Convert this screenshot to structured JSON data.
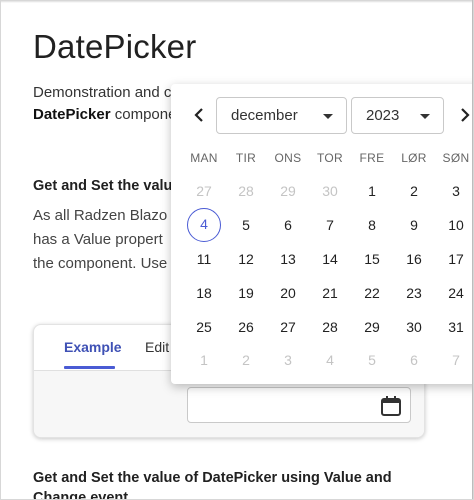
{
  "page": {
    "title": "DatePicker",
    "intro_line1": "Demonstration and c",
    "intro_line2_bold": "DatePicker",
    "intro_line2_rest": " compone"
  },
  "section1": {
    "heading": "Get and Set the valu",
    "body_line1": "As all Radzen Blazo",
    "body_line2": "has a Value propert",
    "body_line3": "the component. Use"
  },
  "card": {
    "tab_example": "Example",
    "tab_edit": "Edit",
    "input_value": ""
  },
  "section2": {
    "heading_line1": "Get and Set the value of DatePicker using Value and",
    "heading_line2": "Change event"
  },
  "calendar": {
    "month": "december",
    "year": "2023",
    "weekdays": [
      "MAN",
      "TIR",
      "ONS",
      "TOR",
      "FRE",
      "LØR",
      "SØN"
    ],
    "weeks": [
      [
        "27",
        "28",
        "29",
        "30",
        "1",
        "2",
        "3"
      ],
      [
        "4",
        "5",
        "6",
        "7",
        "8",
        "9",
        "10"
      ],
      [
        "11",
        "12",
        "13",
        "14",
        "15",
        "16",
        "17"
      ],
      [
        "18",
        "19",
        "20",
        "21",
        "22",
        "23",
        "24"
      ],
      [
        "25",
        "26",
        "27",
        "28",
        "29",
        "30",
        "31"
      ],
      [
        "1",
        "2",
        "3",
        "4",
        "5",
        "6",
        "7"
      ]
    ],
    "other_month": [
      [
        true,
        true,
        true,
        true,
        false,
        false,
        false
      ],
      [
        false,
        false,
        false,
        false,
        false,
        false,
        false
      ],
      [
        false,
        false,
        false,
        false,
        false,
        false,
        false
      ],
      [
        false,
        false,
        false,
        false,
        false,
        false,
        false
      ],
      [
        false,
        false,
        false,
        false,
        false,
        false,
        false
      ],
      [
        true,
        true,
        true,
        true,
        true,
        true,
        true
      ]
    ],
    "today": "4",
    "accent_color": "#4a5bd4",
    "icons": {
      "prev": "chevron-left-icon",
      "next": "chevron-right-icon",
      "dropdown": "caret-down-icon",
      "calendar": "calendar-icon"
    }
  }
}
